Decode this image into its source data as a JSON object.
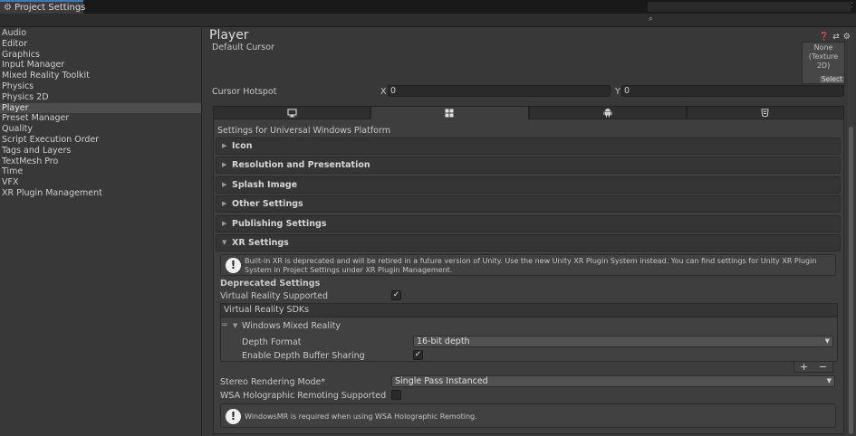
{
  "window": {
    "tab_title": "Project Settings"
  },
  "search": {
    "placeholder": ""
  },
  "sidebar": {
    "items": [
      {
        "label": "Audio"
      },
      {
        "label": "Editor"
      },
      {
        "label": "Graphics"
      },
      {
        "label": "Input Manager"
      },
      {
        "label": "Mixed Reality Toolkit"
      },
      {
        "label": "Physics"
      },
      {
        "label": "Physics 2D"
      },
      {
        "label": "Player",
        "selected": true
      },
      {
        "label": "Preset Manager"
      },
      {
        "label": "Quality"
      },
      {
        "label": "Script Execution Order"
      },
      {
        "label": "Tags and Layers"
      },
      {
        "label": "TextMesh Pro"
      },
      {
        "label": "Time"
      },
      {
        "label": "VFX"
      },
      {
        "label": "XR Plugin Management"
      }
    ]
  },
  "main": {
    "title": "Player",
    "default_cursor_label": "Default Cursor",
    "texture": {
      "line1": "None",
      "line2": "(Texture 2D)",
      "select_label": "Select"
    },
    "cursor_hotspot": {
      "label": "Cursor Hotspot",
      "x_label": "X",
      "x_value": "0",
      "y_label": "Y",
      "y_value": "0"
    },
    "platform_tabs": [
      {
        "icon": "standalone-monitor-icon",
        "selected": false
      },
      {
        "icon": "windows-logo-icon",
        "selected": true
      },
      {
        "icon": "android-icon",
        "selected": false
      },
      {
        "icon": "webgl-icon",
        "selected": false
      }
    ],
    "platform_settings_title": "Settings for Universal Windows Platform",
    "sections": [
      {
        "label": "Icon",
        "expanded": false
      },
      {
        "label": "Resolution and Presentation",
        "expanded": false
      },
      {
        "label": "Splash Image",
        "expanded": false
      },
      {
        "label": "Other Settings",
        "expanded": false
      },
      {
        "label": "Publishing Settings",
        "expanded": false
      },
      {
        "label": "XR Settings",
        "expanded": true
      }
    ],
    "xr": {
      "deprecation_warning": "Built-in XR is deprecated and will be retired in a future version of Unity. Use the new Unity XR Plugin System instead. You can find settings for Unity XR Plugin System in Project Settings under XR Plugin Management.",
      "deprecated_settings_label": "Deprecated Settings",
      "vr_supported_label": "Virtual Reality Supported",
      "vr_supported": true,
      "vr_sdks_label": "Virtual Reality SDKs",
      "sdk_name": "Windows Mixed Reality",
      "depth_format_label": "Depth Format",
      "depth_format_value": "16-bit depth",
      "depth_buffer_sharing_label": "Enable Depth Buffer Sharing",
      "depth_buffer_sharing": true,
      "stereo_mode_label": "Stereo Rendering Mode*",
      "stereo_mode_value": "Single Pass Instanced",
      "wsa_remoting_label": "WSA Holographic Remoting Supported",
      "wsa_remoting": false,
      "wsa_info": "WindowsMR is required when using WSA Holographic Remoting."
    }
  }
}
